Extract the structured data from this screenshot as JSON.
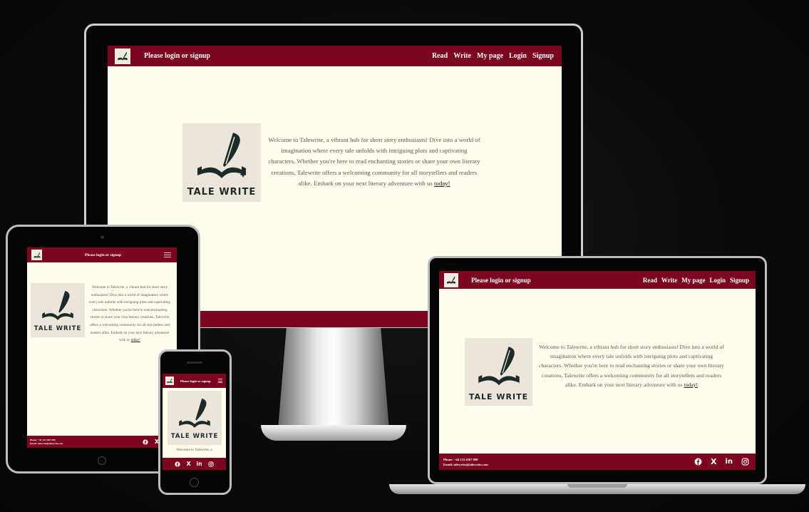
{
  "site": {
    "nav_title": "Please login or signup",
    "logo_text": "TALE WRITE",
    "links": [
      "Read",
      "Write",
      "My page",
      "Login",
      "Signup"
    ],
    "intro_text": "Welcome to Talewrite, a vibrant hub for short story enthusiasts! Dive into a world of imagination where every tale unfolds with intriguing plots and captivating characters. Whether you're here to read enchanting stories or share your own literary creations, Talewrite offers a welcoming community for all storytellers and readers alike. Embark on your next literary adventure with us ",
    "intro_link": "today!",
    "phone_intro_text": "Welcome to Talewrite, a",
    "footer_phone": "Phone: +44 123 4567 890",
    "footer_email": "Email: talewrite@talewrite.com",
    "social_icons": [
      "facebook-icon",
      "x-icon",
      "linkedin-icon",
      "instagram-icon"
    ]
  },
  "colors": {
    "brand": "#7c0520",
    "page_bg": "#fffdec",
    "text": "#5a5a5a",
    "logo_bg": "#ece6da",
    "logo_ink": "#1d2a2a"
  }
}
